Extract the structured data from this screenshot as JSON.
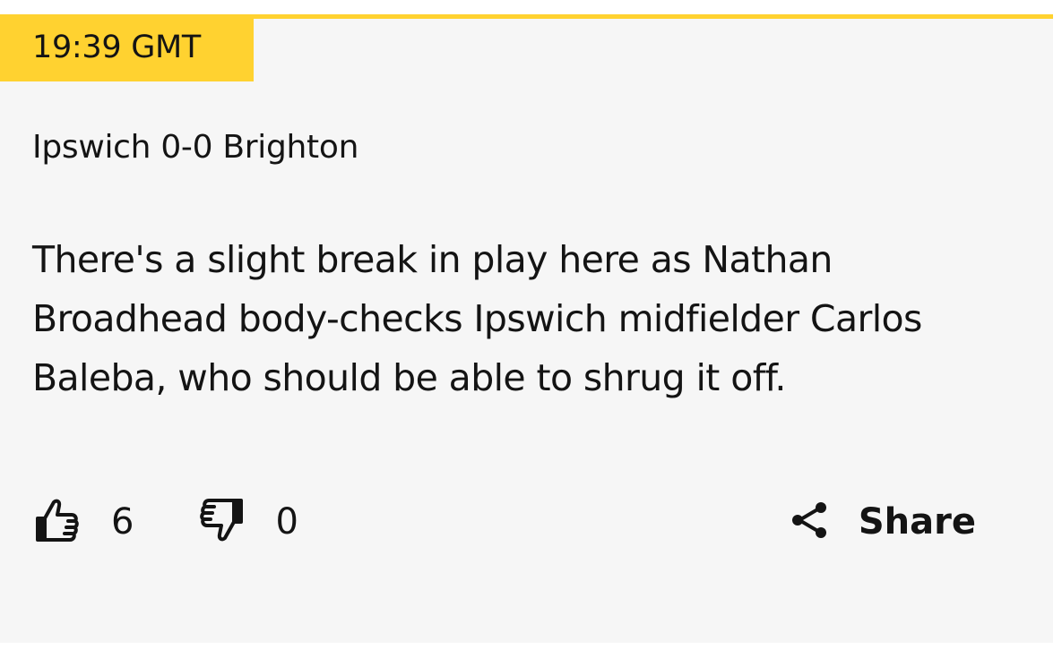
{
  "post": {
    "timestamp": "19:39 GMT",
    "headline": "Ipswich 0-0 Brighton",
    "body": "There's a slight break in play here as Nathan Broadhead body-checks Ipswich midfielder Carlos Baleba, who should be able to shrug it off."
  },
  "reactions": {
    "likes": "6",
    "dislikes": "0",
    "like_icon": "thumbs-up-icon",
    "dislike_icon": "thumbs-down-icon"
  },
  "share": {
    "label": "Share",
    "icon": "share-icon"
  },
  "colors": {
    "accent": "#ffd230",
    "card_background": "#f6f6f6",
    "text": "#141414"
  }
}
